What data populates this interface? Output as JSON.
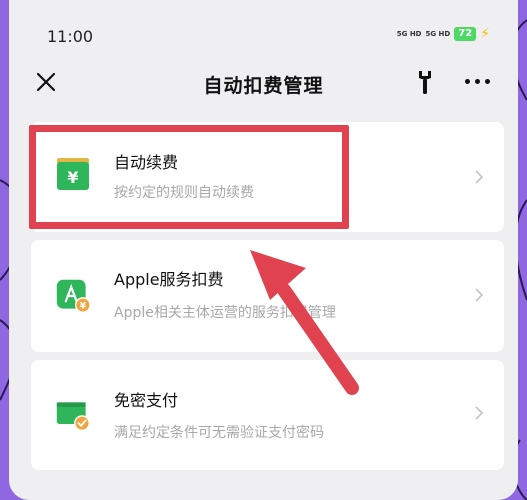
{
  "status_bar": {
    "time": "11:00",
    "signal_1": "5G HD",
    "signal_2": "5G HD",
    "battery": "72"
  },
  "nav": {
    "title": "自动扣费管理"
  },
  "items": [
    {
      "title": "自动续费",
      "subtitle": "按约定的规则自动续费",
      "icon": "yuan-card-icon"
    },
    {
      "title": "Apple服务扣费",
      "subtitle": "Apple相关主体运营的服务扣费管理",
      "icon": "app-store-yuan-icon"
    },
    {
      "title": "免密支付",
      "subtitle": "满足约定条件可无需验证支付密码",
      "icon": "wallet-check-icon"
    }
  ],
  "colors": {
    "accent_green": "#2fb65a",
    "highlight_red": "#e0424f",
    "background_purple": "#8f67e0"
  }
}
